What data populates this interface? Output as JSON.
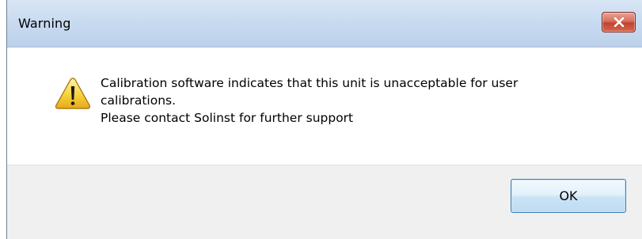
{
  "window": {
    "title": "Warning",
    "close_icon": "close-icon"
  },
  "dialog": {
    "icon": "warning-icon",
    "message_lines": [
      "Calibration software indicates that this unit is unacceptable for user",
      "calibrations.",
      "Please contact Solinst for further support"
    ],
    "ok_label": "OK"
  },
  "colors": {
    "titlebar": "#c9dbf0",
    "close_button": "#c2432f",
    "footer": "#f0f0f0",
    "ok_button_border": "#3c7fb1",
    "warning_yellow": "#f6d33c"
  }
}
